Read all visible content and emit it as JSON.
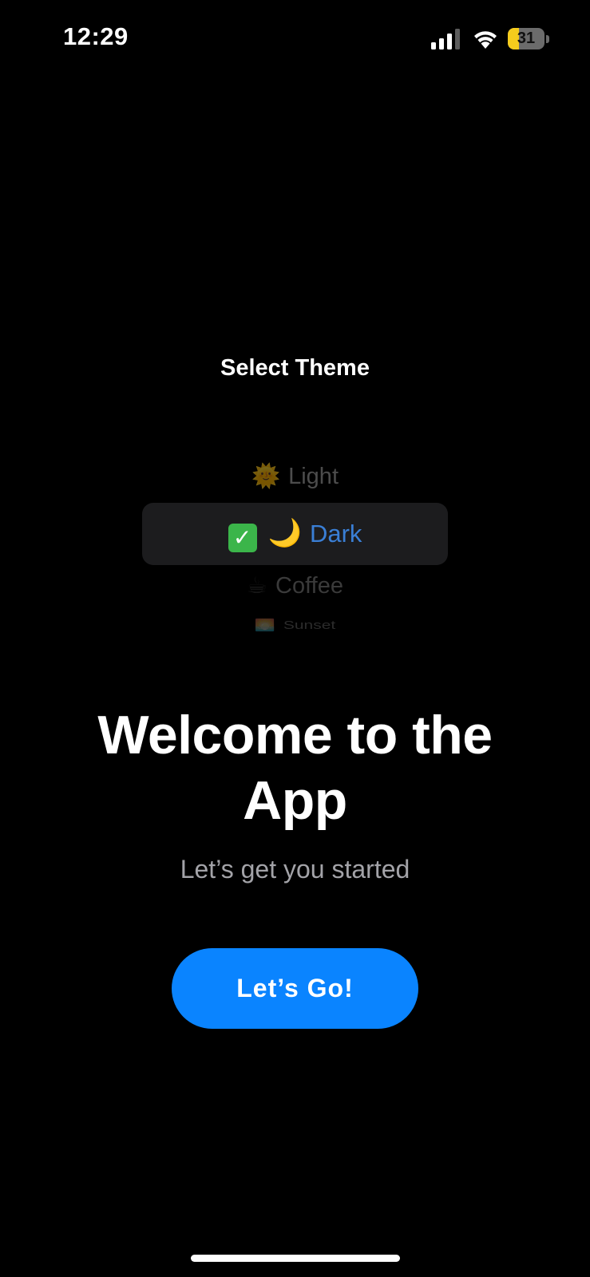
{
  "status_bar": {
    "time": "12:29",
    "battery_level": "31",
    "battery_fraction": 0.31,
    "signal_icon": "cellular-signal-icon",
    "wifi_icon": "wifi-icon"
  },
  "theme_picker": {
    "title": "Select Theme",
    "options": [
      {
        "emoji": "🌞",
        "label": "Light",
        "selected": false
      },
      {
        "emoji": "🌙",
        "label": "Dark",
        "selected": true,
        "check": "✓"
      },
      {
        "emoji": "☕",
        "label": "Coffee",
        "selected": false
      },
      {
        "emoji": "🌅",
        "label": "Sunset",
        "selected": false
      }
    ]
  },
  "welcome": {
    "title": "Welcome to the App",
    "subtitle": "Let’s get you started",
    "button_label": "Let’s Go!"
  },
  "colors": {
    "background": "#000000",
    "accent": "#0a84ff",
    "selected_text": "#3a7fd6",
    "subtitle": "#a3a3a8",
    "battery": "#f5cc1d"
  }
}
